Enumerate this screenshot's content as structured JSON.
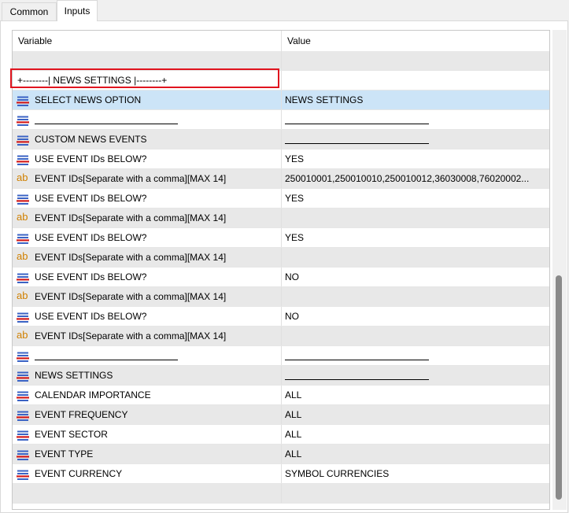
{
  "tabs": [
    {
      "label": "Common",
      "active": false
    },
    {
      "label": "Inputs",
      "active": true
    }
  ],
  "grid": {
    "headers": {
      "variable": "Variable",
      "value": "Value"
    },
    "rows": [
      {
        "type": "blank",
        "variable": "",
        "value": "",
        "icon": "none",
        "shade": "alt"
      },
      {
        "type": "group",
        "variable": "+--------| NEWS SETTINGS |--------+",
        "value": "",
        "icon": "none",
        "shade": "white",
        "highlighted": true
      },
      {
        "type": "enum",
        "variable": "SELECT NEWS OPTION",
        "value": "NEWS SETTINGS",
        "icon": "enum-icon",
        "shade": "sel"
      },
      {
        "type": "enum",
        "variable": "",
        "value": "",
        "icon": "enum-icon",
        "shade": "white",
        "underline_var": true,
        "underline_val": true
      },
      {
        "type": "enum",
        "variable": "CUSTOM NEWS EVENTS",
        "value": "",
        "icon": "enum-icon",
        "shade": "alt",
        "underline_val": true
      },
      {
        "type": "enum",
        "variable": "USE EVENT IDs BELOW?",
        "value": "YES",
        "icon": "enum-icon",
        "shade": "white"
      },
      {
        "type": "string",
        "variable": "EVENT IDs[Separate with a comma][MAX 14]",
        "value": "250010001,250010010,250010012,36030008,76020002...",
        "icon": "string-icon",
        "shade": "alt"
      },
      {
        "type": "enum",
        "variable": "USE EVENT IDs BELOW?",
        "value": "YES",
        "icon": "enum-icon",
        "shade": "white"
      },
      {
        "type": "string",
        "variable": "EVENT IDs[Separate with a comma][MAX 14]",
        "value": "",
        "icon": "string-icon",
        "shade": "alt"
      },
      {
        "type": "enum",
        "variable": "USE EVENT IDs BELOW?",
        "value": "YES",
        "icon": "enum-icon",
        "shade": "white"
      },
      {
        "type": "string",
        "variable": "EVENT IDs[Separate with a comma][MAX 14]",
        "value": "",
        "icon": "string-icon",
        "shade": "alt"
      },
      {
        "type": "enum",
        "variable": "USE EVENT IDs BELOW?",
        "value": "NO",
        "icon": "enum-icon",
        "shade": "white"
      },
      {
        "type": "string",
        "variable": "EVENT IDs[Separate with a comma][MAX 14]",
        "value": "",
        "icon": "string-icon",
        "shade": "alt"
      },
      {
        "type": "enum",
        "variable": "USE EVENT IDs BELOW?",
        "value": "NO",
        "icon": "enum-icon",
        "shade": "white"
      },
      {
        "type": "string",
        "variable": "EVENT IDs[Separate with a comma][MAX 14]",
        "value": "",
        "icon": "string-icon",
        "shade": "alt"
      },
      {
        "type": "enum",
        "variable": "",
        "value": "",
        "icon": "enum-icon",
        "shade": "white",
        "underline_var": true,
        "underline_val": true
      },
      {
        "type": "enum",
        "variable": "NEWS SETTINGS",
        "value": "",
        "icon": "enum-icon",
        "shade": "alt",
        "underline_val": true
      },
      {
        "type": "enum",
        "variable": "CALENDAR IMPORTANCE",
        "value": "ALL",
        "icon": "enum-icon",
        "shade": "white"
      },
      {
        "type": "enum",
        "variable": "EVENT FREQUENCY",
        "value": "ALL",
        "icon": "enum-icon",
        "shade": "alt"
      },
      {
        "type": "enum",
        "variable": "EVENT SECTOR",
        "value": "ALL",
        "icon": "enum-icon",
        "shade": "white"
      },
      {
        "type": "enum",
        "variable": "EVENT TYPE",
        "value": "ALL",
        "icon": "enum-icon",
        "shade": "alt"
      },
      {
        "type": "enum",
        "variable": "EVENT CURRENCY",
        "value": "SYMBOL CURRENCIES",
        "icon": "enum-icon",
        "shade": "white"
      },
      {
        "type": "blank",
        "variable": "",
        "value": "",
        "icon": "none",
        "shade": "alt"
      }
    ]
  },
  "colors": {
    "selection": "#cce4f7",
    "highlight_border": "#e0141e",
    "string_icon": "#d08000"
  },
  "icons": {
    "enum": "enum-icon",
    "string": "string-icon",
    "string_glyph": "ab"
  }
}
